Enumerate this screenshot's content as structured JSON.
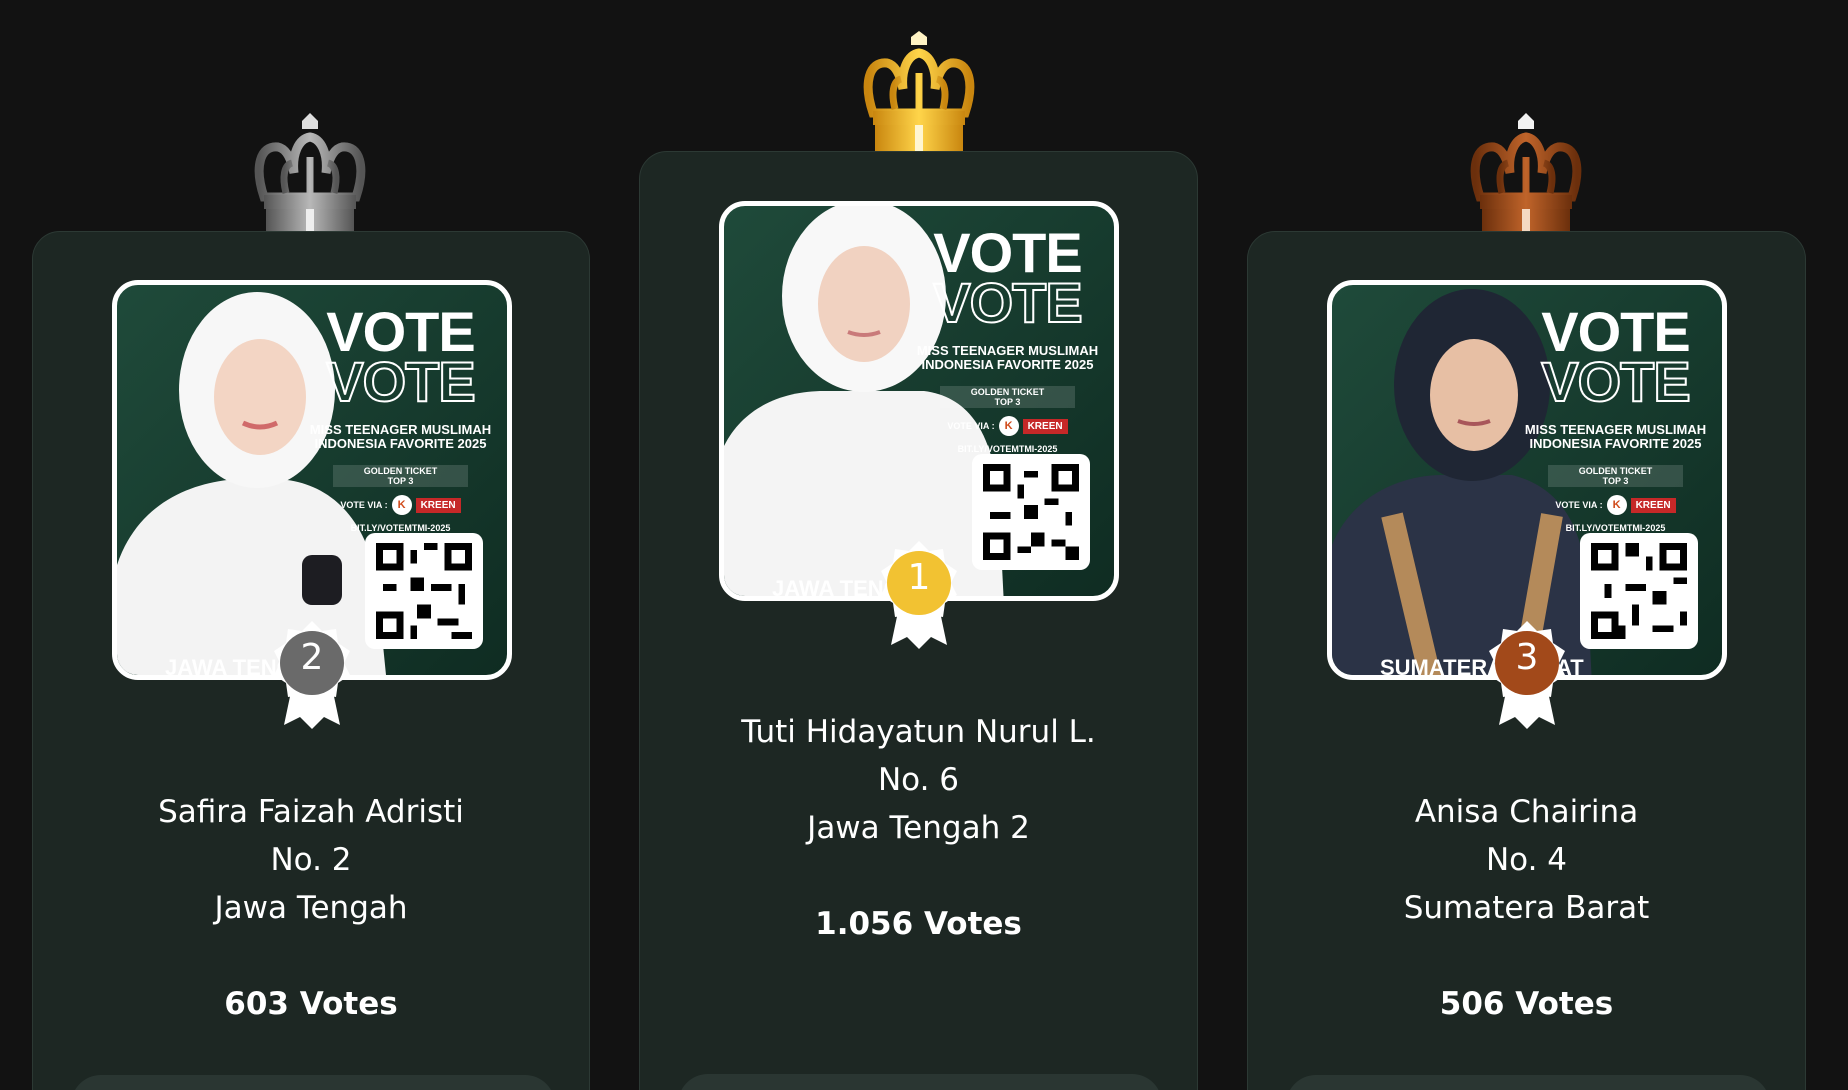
{
  "colors": {
    "background": "#121212",
    "card": "#1d2723",
    "silver": "#8c8c8c",
    "gold": "#f0b92a",
    "bronze": "#a0501e"
  },
  "poster": {
    "vote_word": "VOTE",
    "subtitle": "MISS TEENAGER MUSLIMAH\nINDONESIA FAVORITE 2025",
    "ticket": "GOLDEN TICKET\nTOP 3",
    "via_label": "VOTE VIA :",
    "kreen": "KREEN",
    "link": "BIT.LY/VOTEMTMI-2025"
  },
  "leaderboard": [
    {
      "rank": "2",
      "crown_icon": "silver-crown-icon",
      "name": "Safira Faizah Adristi",
      "number": "No. 2",
      "region": "Jawa Tengah",
      "votes": "603 Votes",
      "caption": "JAWA TENGAH"
    },
    {
      "rank": "1",
      "crown_icon": "gold-crown-icon",
      "name": "Tuti Hidayatun Nurul L.",
      "number": "No. 6",
      "region": "Jawa Tengah 2",
      "votes": "1.056 Votes",
      "caption": "JAWA TENGAH 2"
    },
    {
      "rank": "3",
      "crown_icon": "bronze-crown-icon",
      "name": "Anisa Chairina",
      "number": "No. 4",
      "region": "Sumatera Barat",
      "votes": "506 Votes",
      "caption": "SUMATERA BARAT"
    }
  ]
}
